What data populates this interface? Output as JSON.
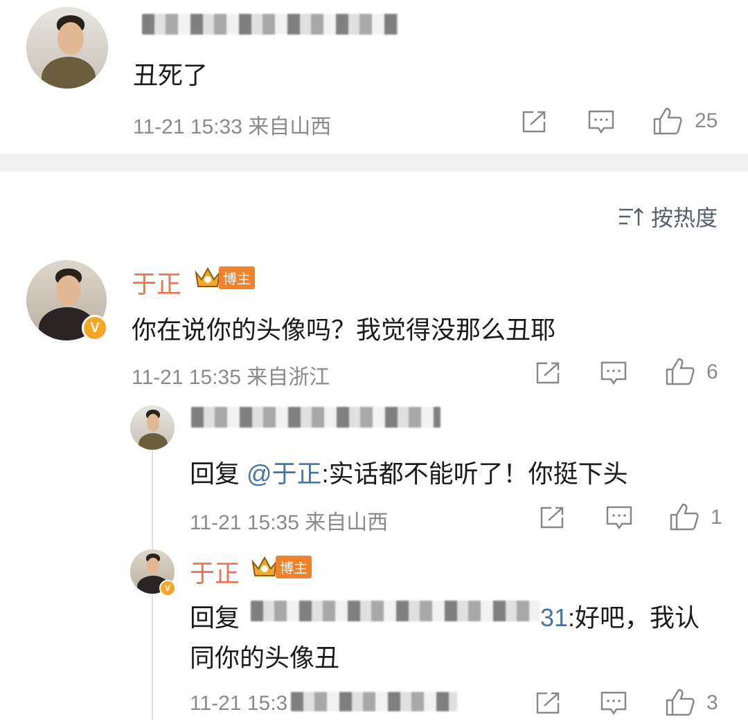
{
  "comment1": {
    "text": "丑死了",
    "time": "11-21 15:33",
    "location": "来自山西",
    "likes": "25"
  },
  "sort": {
    "label": "按热度"
  },
  "comment2": {
    "name": "于正",
    "badge": "博主",
    "text": "你在说你的头像吗？我觉得没那么丑耶",
    "time": "11-21 15:35",
    "location": "来自浙江",
    "likes": "6",
    "verified": "V"
  },
  "reply1": {
    "prefix": "回复 ",
    "mention": "@于正",
    "text": ":实话都不能听了！你挺下头",
    "time": "11-21 15:35",
    "location": "来自山西",
    "likes": "1"
  },
  "reply2": {
    "name": "于正",
    "badge": "博主",
    "prefix": "回复",
    "mention_suffix": "31",
    "text_line1": ":好吧，我认",
    "text_line2": "同你的头像丑",
    "time": "11-21 15:3",
    "likes": "3",
    "verified": "V"
  },
  "icons": {
    "share": "share-icon",
    "comment": "comment-icon",
    "like": "thumbs-up-icon",
    "sort": "sort-icon",
    "crown": "crown-icon"
  },
  "colors": {
    "name": "#eb7350",
    "mention": "#4673aa",
    "meta": "#8a8a8a",
    "badge": "#f0822d",
    "verified": "#f5a623"
  }
}
